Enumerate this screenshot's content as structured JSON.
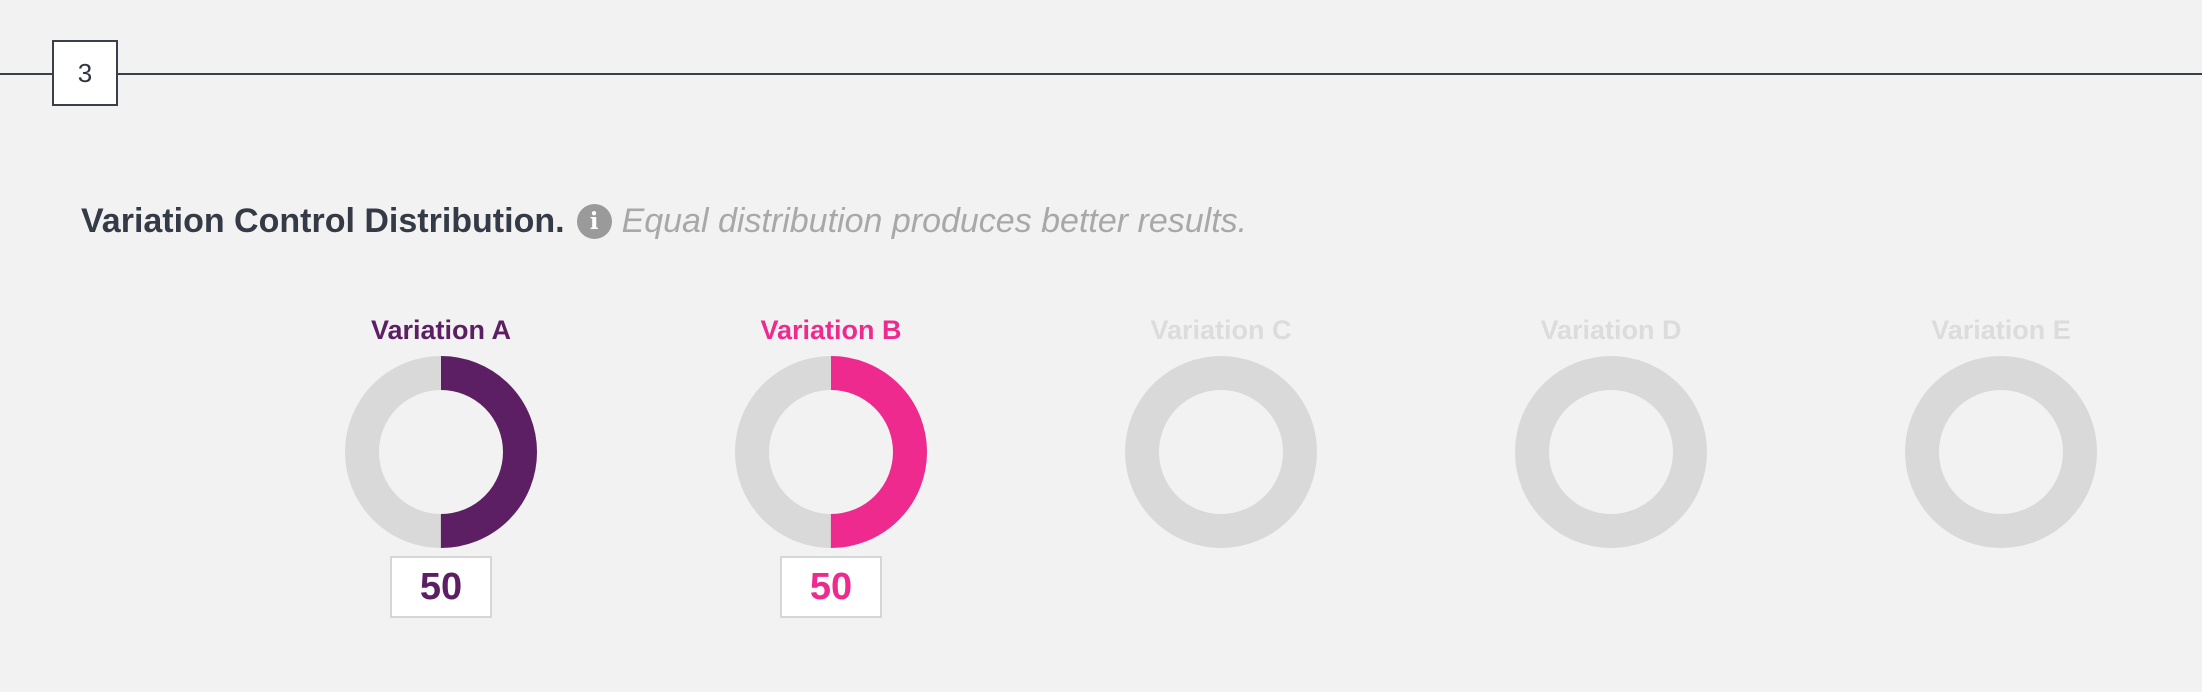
{
  "step": {
    "number": "3"
  },
  "heading": {
    "title": "Variation Control Distribution.",
    "info_icon": "info-icon",
    "hint": "Equal distribution produces better results."
  },
  "variations": [
    {
      "label": "Variation A",
      "value": "50",
      "percent": 50,
      "active": true,
      "color": "#5c1f63"
    },
    {
      "label": "Variation B",
      "value": "50",
      "percent": 50,
      "active": true,
      "color": "#ee2a8f"
    },
    {
      "label": "Variation C",
      "value": "",
      "percent": 0,
      "active": false,
      "color": "#dcdcdc"
    },
    {
      "label": "Variation D",
      "value": "",
      "percent": 0,
      "active": false,
      "color": "#dcdcdc"
    },
    {
      "label": "Variation E",
      "value": "",
      "percent": 0,
      "active": false,
      "color": "#dcdcdc"
    }
  ],
  "colors": {
    "track": "#d9d9d9",
    "inactive_label": "#dcdcdc",
    "heading": "#343a46",
    "hint": "#a8a8a8"
  }
}
